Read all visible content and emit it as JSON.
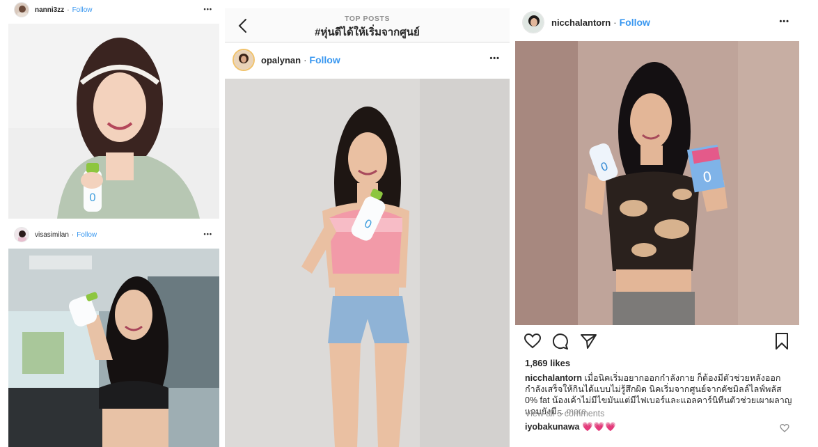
{
  "left": {
    "post1": {
      "username": "nanni3zz",
      "follow": "Follow",
      "more": "•••"
    },
    "post2": {
      "username": "visasimilan",
      "follow": "Follow",
      "more": "•••"
    }
  },
  "middle": {
    "top_label": "TOP POSTS",
    "hashtag": "#หุ่นดีได้ให้เริ่มจากศูนย์",
    "post": {
      "username": "opalynan",
      "follow": "Follow",
      "more": "•••"
    }
  },
  "right": {
    "post": {
      "username": "nicchalantorn",
      "follow": "Follow",
      "more": "•••"
    },
    "likes": "1,869 likes",
    "caption_user": "nicchalantorn",
    "caption_text": "เมื่อนิคเริ่มอยากออกกำลังกาย ก็ต้องมีตัวช่วยหลังออกกำลังเสร็จให้กินได้แบบไม่รู้สึกผิด นิคเริ่มจากศูนย์จากดัชมิลล์ไลฟ์พลัส 0% fat น้องเค้าไม่มีไขมันแต่มีไฟเบอร์และแอลคาร์นิทีนตัวช่วยเผาผลาญ แถมยังมี...",
    "caption_more": "more",
    "view_all": "View all 5 comments",
    "comment_user": "iyobakunawa",
    "comment_text": "💗💗💗"
  },
  "colors": {
    "link_blue": "#3897f0",
    "text": "#262626",
    "muted": "#8e8e8e"
  }
}
